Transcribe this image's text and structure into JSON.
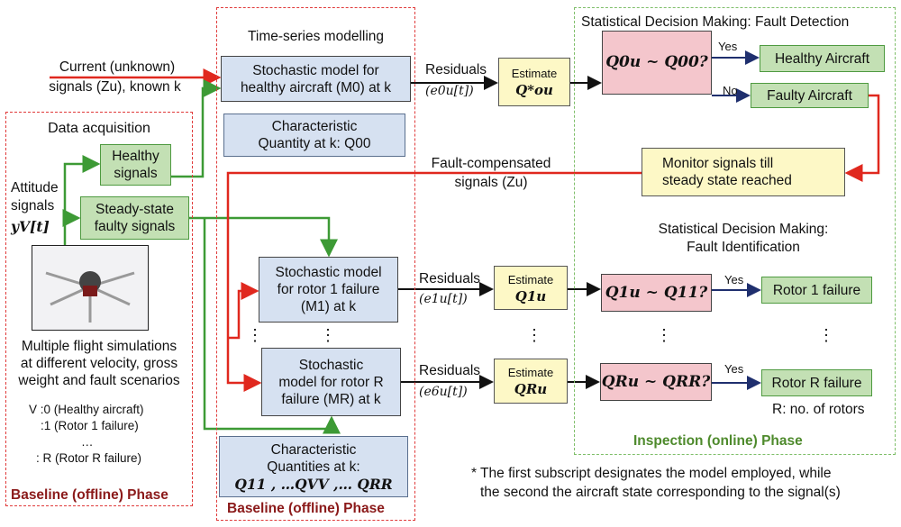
{
  "colors": {
    "red_arrow": "#e0281e",
    "green_arrow": "#3d9a35",
    "dark_arrow": "#1f2f6e",
    "blue_box": "#d6e1f1",
    "green_box": "#c3e0b4",
    "yellow_box": "#fdf8c6",
    "pink_box": "#f4c6cc",
    "phase_red": "#8b1a1a",
    "phase_green": "#4e8a2c"
  },
  "input": {
    "line1": "Current (unknown)",
    "line2": "signals (Zu), known k"
  },
  "data_acq": {
    "title": "Data acquisition",
    "attitude1": "Attitude",
    "attitude2": "signals",
    "attitude3": "yV[t]",
    "healthy1": "Healthy",
    "healthy2": "signals",
    "steady1": "Steady-state",
    "steady2": "faulty signals",
    "drone_image": "hexacopter-photo",
    "sim1": "Multiple flight simulations",
    "sim2": "at different velocity, gross",
    "sim3": "weight and fault scenarios",
    "v0": "V :0  (Healthy aircraft)",
    "v1": ":1  (Rotor 1 failure)",
    "vdots": "…",
    "vR": ": R (Rotor R failure)",
    "phase": "Baseline (offline) Phase"
  },
  "ts": {
    "title": "Time-series modelling",
    "m0a": "Stochastic model for",
    "m0b": "healthy aircraft (M0) at k",
    "q00a": "Characteristic",
    "q00b": "Quantity at k: Q00",
    "m1a": "Stochastic model",
    "m1b": "for rotor 1 failure",
    "m1c": "(M1) at k",
    "mra": "Stochastic",
    "mrb": "model for rotor R",
    "mrc": "failure (MR) at k",
    "dots": "⋮",
    "qa": "Characteristic",
    "qb": "Quantities at k:",
    "qc": "Q11 , …QVV ,… QRR",
    "phase": "Baseline (offline) Phase"
  },
  "residuals": [
    {
      "label": "Residuals",
      "sig": "(e0u[t])",
      "est": "Estimate",
      "q": "Q*ou"
    },
    {
      "label": "Residuals",
      "sig": "(e1u[t])",
      "est": "Estimate",
      "q": "Q1u"
    },
    {
      "label": "Residuals",
      "sig": "(e6u[t])",
      "est": "Estimate",
      "q": "QRu"
    }
  ],
  "fault_comp": {
    "line1": "Fault-compensated",
    "line2": "signals (Zu)"
  },
  "inspection": {
    "detect_title": "Statistical Decision Making: Fault Detection",
    "q0": "Q0u ~ Q00?",
    "yes": "Yes",
    "no": "No",
    "healthy": "Healthy Aircraft",
    "faulty": "Faulty Aircraft",
    "monitor1": "Monitor signals till",
    "monitor2": "steady state reached",
    "ident1": "Statistical Decision Making:",
    "ident2": "Fault Identification",
    "q1": "Q1u ~ Q11?",
    "qR": "QRu ~ QRR?",
    "rotor1": "Rotor 1 failure",
    "rotorR": "Rotor R failure",
    "rnote": "R: no. of rotors",
    "phase": "Inspection (online) Phase",
    "dots": "⋮"
  },
  "footnote": {
    "line1": "* The first subscript designates the model employed, while",
    "line2": "the second the aircraft state corresponding to the signal(s)"
  }
}
